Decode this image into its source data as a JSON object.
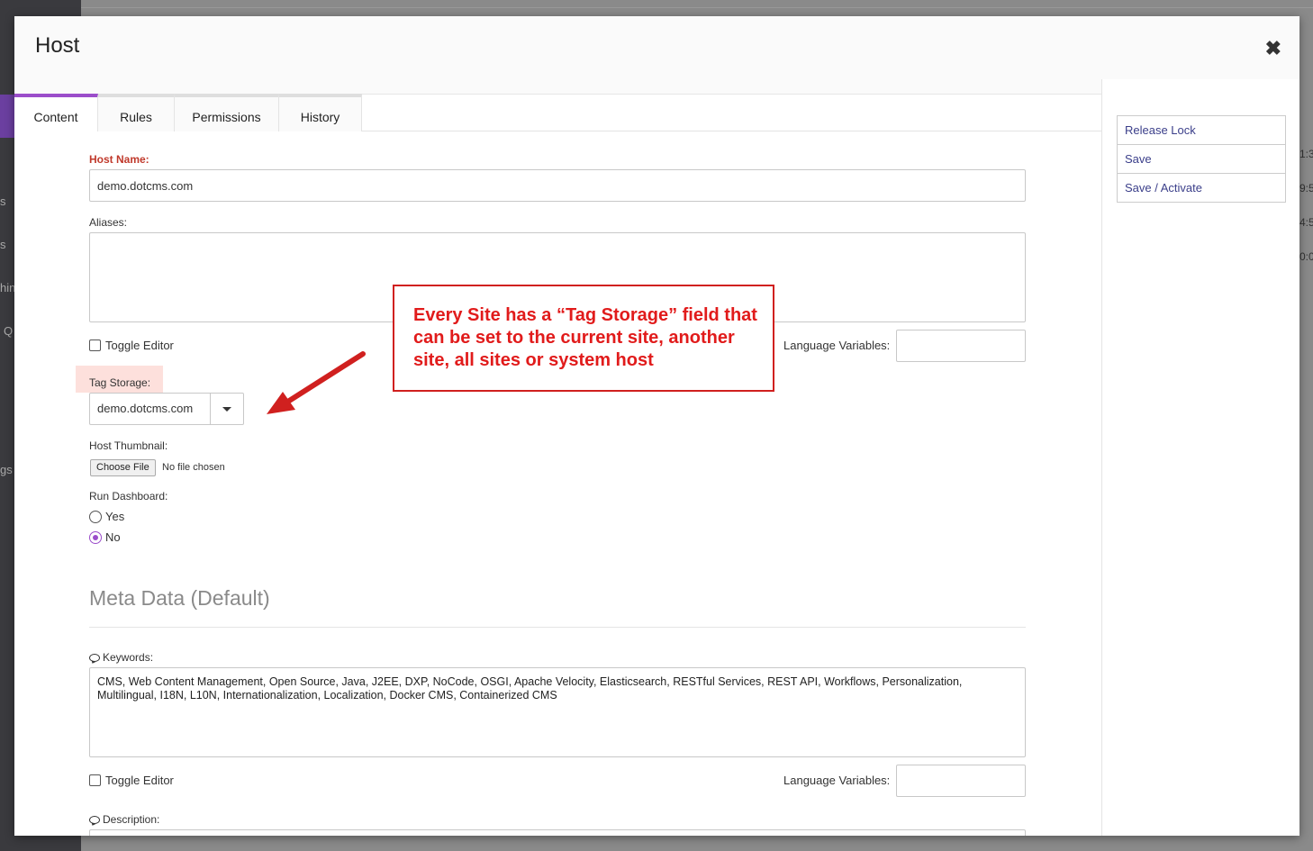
{
  "background": {
    "sidebar_fragments": [
      "s",
      "s",
      "hin",
      "Q",
      "gs"
    ],
    "right_fragments": [
      "1:3",
      "9:5",
      "4:5",
      "0:0"
    ]
  },
  "dialog": {
    "title": "Host",
    "close_icon": "close-icon"
  },
  "tabs": [
    {
      "label": "Content",
      "active": true
    },
    {
      "label": "Rules",
      "active": false
    },
    {
      "label": "Permissions",
      "active": false
    },
    {
      "label": "History",
      "active": false
    }
  ],
  "actions": {
    "release_lock": "Release Lock",
    "save": "Save",
    "save_activate": "Save / Activate"
  },
  "form": {
    "host_name_label": "Host Name:",
    "host_name_value": "demo.dotcms.com",
    "aliases_label": "Aliases:",
    "aliases_value": "",
    "toggle_editor_label": "Toggle Editor",
    "language_variables_label": "Language Variables:",
    "tag_storage_label": "Tag Storage:",
    "tag_storage_value": "demo.dotcms.com",
    "host_thumbnail_label": "Host Thumbnail:",
    "choose_file_label": "Choose File",
    "no_file_text": "No file chosen",
    "run_dashboard_label": "Run Dashboard:",
    "run_dashboard_yes": "Yes",
    "run_dashboard_no": "No",
    "run_dashboard_selected": "No"
  },
  "meta": {
    "section_title": "Meta Data (Default)",
    "keywords_label": "Keywords:",
    "keywords_value": "CMS, Web Content Management, Open Source, Java, J2EE, DXP, NoCode, OSGI, Apache Velocity, Elasticsearch, RESTful Services, REST API, Workflows, Personalization, Multilingual, I18N, L10N, Internationalization, Localization, Docker CMS, Containerized CMS",
    "toggle_editor_label": "Toggle Editor",
    "language_variables_label": "Language Variables:",
    "description_label": "Description:"
  },
  "annotation": {
    "text": "Every Site has a “Tag Storage” field that can be set to the current site, another site, all sites or system host",
    "color": "#e11b1b"
  },
  "colors": {
    "accent": "#9b4dca",
    "required": "#c0392b",
    "link": "#3b3f8a"
  }
}
